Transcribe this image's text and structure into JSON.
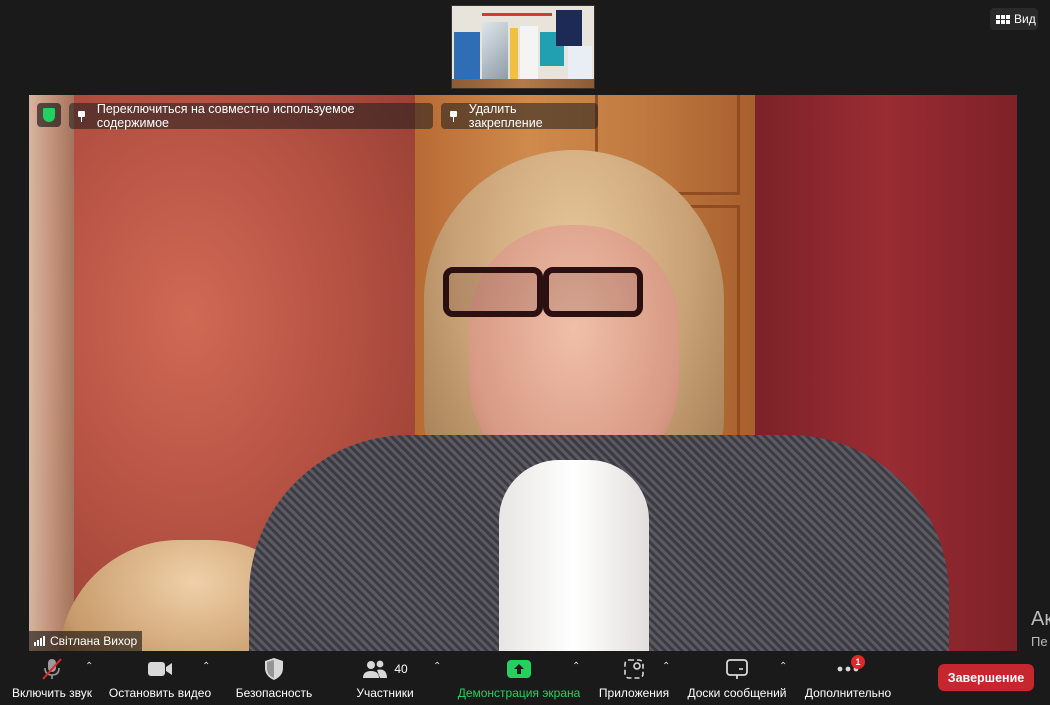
{
  "top": {
    "view_label": "Вид"
  },
  "video": {
    "pin_switch_label": "Переключиться на совместно используемое содержимое",
    "pin_remove_label": "Удалить закрепление",
    "participant_name": "Світлана Вихор"
  },
  "toolbar": {
    "mute_label": "Включить звук",
    "video_label": "Остановить видео",
    "security_label": "Безопасность",
    "participants_label": "Участники",
    "participants_count": "40",
    "share_label": "Демонстрация экрана",
    "apps_label": "Приложения",
    "whiteboards_label": "Доски сообщений",
    "more_label": "Дополнительно",
    "more_badge": "1",
    "end_label": "Завершение"
  },
  "side_text": [
    "Ак",
    "Пе",
    "ак"
  ],
  "colors": {
    "end_button": "#c6262e",
    "share_green": "#23d160",
    "security_shield": "#23d160"
  }
}
